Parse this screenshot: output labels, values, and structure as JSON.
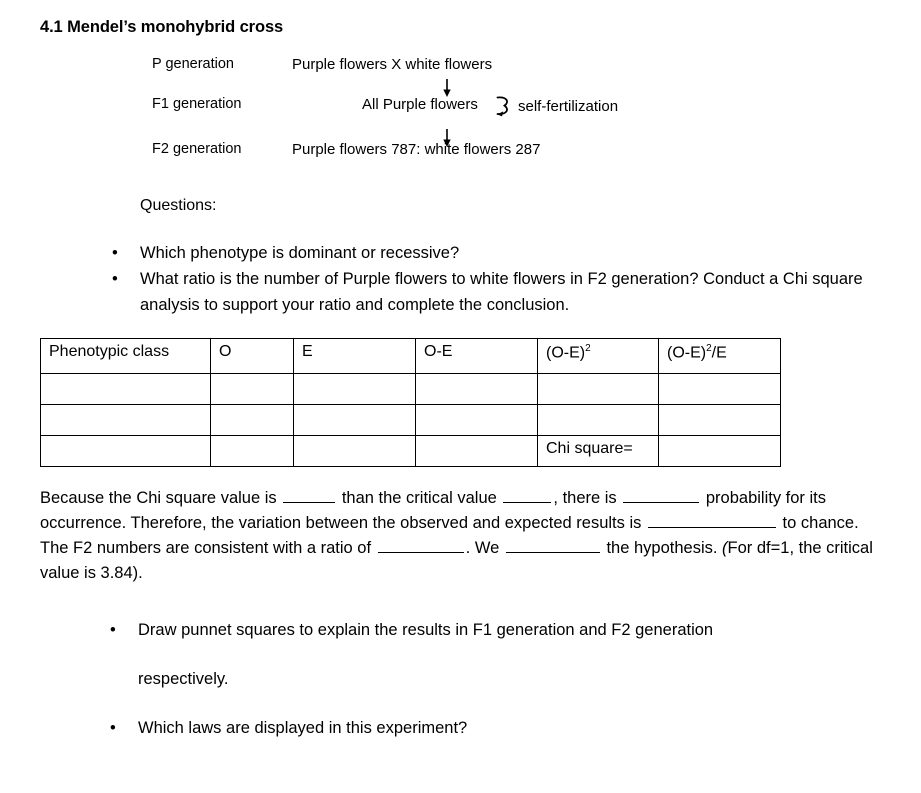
{
  "document": {
    "title": "4.1 Mendel’s monohybrid cross"
  },
  "cross_diagram": {
    "rows": [
      {
        "label": "P generation",
        "content": "Purple flowers X white flowers"
      },
      {
        "label": "F1 generation",
        "content": "All Purple flowers"
      },
      {
        "label": "F2 generation",
        "content": "Purple flowers 787: white flowers 287"
      }
    ],
    "self_fertilization_label": "self-fertilization",
    "arrow_icon_name": "down-arrow-icon",
    "loop_icon_name": "self-fertilization-loop-icon"
  },
  "questions": {
    "heading": "Questions:",
    "bullet_glyph": "•",
    "items": [
      "Which phenotype is dominant or recessive?",
      "What ratio is the number of Purple flowers to white flowers in F2 generation? Conduct a Chi square analysis to support your ratio and complete the conclusion."
    ]
  },
  "chi_table": {
    "headers": [
      "Phenotypic class",
      "O",
      "E",
      "O-E",
      "(O-E)",
      "(O-E)"
    ],
    "header_sups": [
      "",
      "",
      "",
      "",
      "2",
      "2"
    ],
    "header_suffixes": [
      "",
      "",
      "",
      "",
      "",
      "/E"
    ],
    "rows": [
      [
        "",
        "",
        "",
        "",
        "",
        ""
      ],
      [
        "",
        "",
        "",
        "",
        "",
        ""
      ],
      [
        "",
        "",
        "",
        "",
        "Chi square=",
        ""
      ]
    ]
  },
  "conclusion": {
    "seg1": "Because the Chi square value is ",
    "seg2": " than the critical value ",
    "seg3": ", there is ",
    "seg4": " probability for its occurrence. Therefore, the variation between the observed and expected results is ",
    "seg5": " to chance. The F2 numbers are consistent with a ratio of ",
    "seg6": ". We ",
    "seg7": " the hypothesis. ",
    "seg8_italic": "(",
    "seg9": "For df=1, the critical value is 3.84)."
  },
  "bottom_bullets": {
    "bullet_glyph": "•",
    "item1_line1": "Draw punnet squares to explain the results in F1 generation and F2 generation",
    "item1_line2": "respectively.",
    "item2": "Which laws are displayed in this experiment?"
  }
}
